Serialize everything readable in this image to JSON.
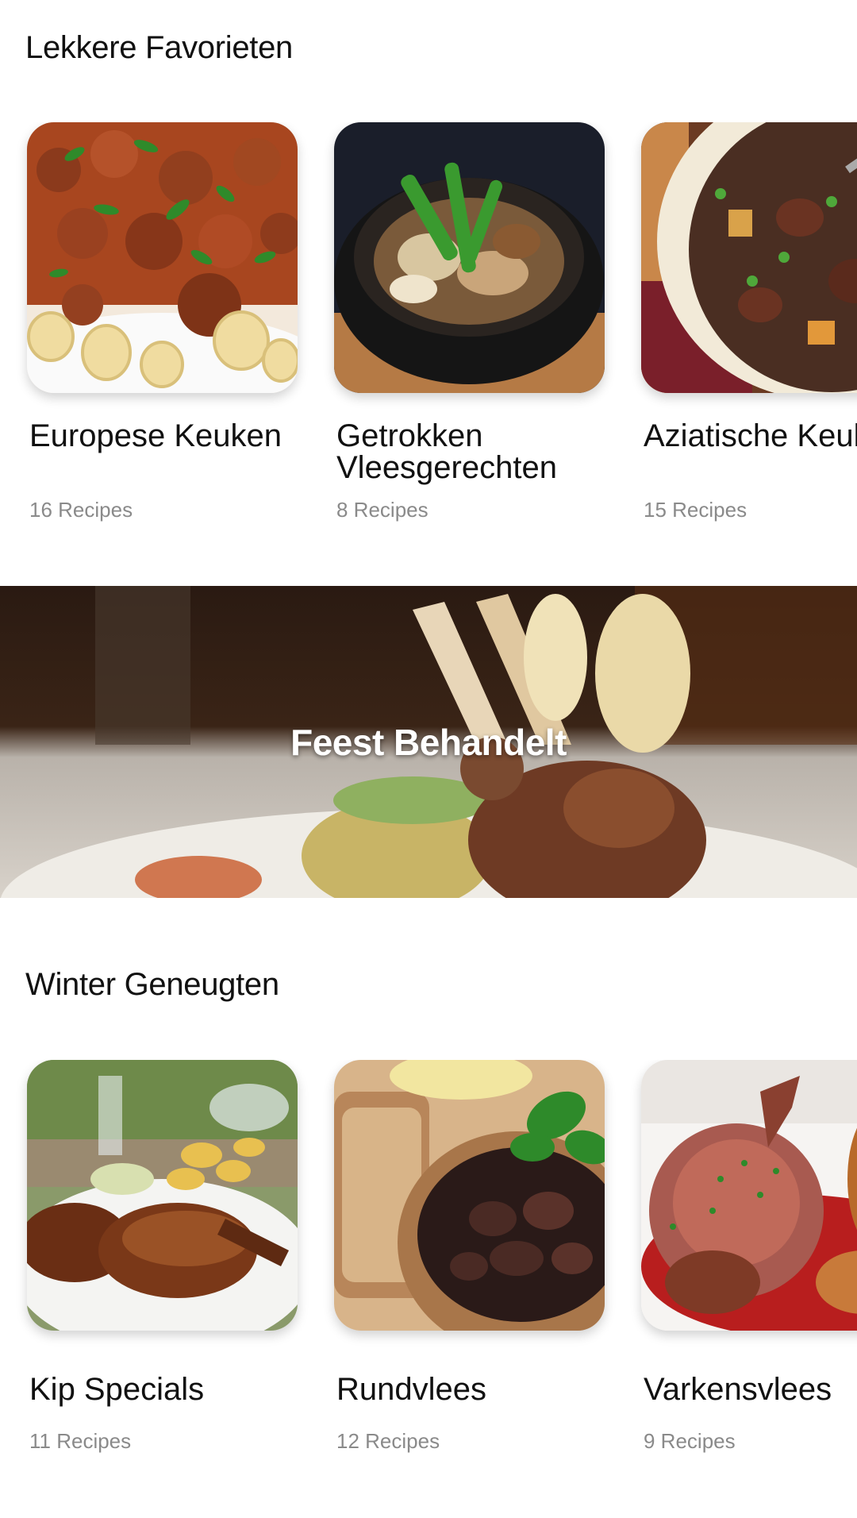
{
  "sections": [
    {
      "title": "Lekkere Favorieten",
      "cards": [
        {
          "title": "Europese Keuken",
          "count": "16 Recipes",
          "image": "pasta-bolognese-photo"
        },
        {
          "title": "Getrokken Vleesgerechten",
          "count": "8 Recipes",
          "image": "braised-meat-pot-photo"
        },
        {
          "title": "Aziatische Keuken",
          "count": "15 Recipes",
          "image": "stew-pot-photo"
        }
      ]
    },
    {
      "title": "Winter Geneugten",
      "cards": [
        {
          "title": "Kip Specials",
          "count": "11 Recipes",
          "image": "grilled-chicken-photo"
        },
        {
          "title": "Rundvlees",
          "count": "12 Recipes",
          "image": "beef-stew-bowl-photo"
        },
        {
          "title": "Varkensvlees",
          "count": "9 Recipes",
          "image": "roast-pork-photo"
        }
      ]
    }
  ],
  "banner": {
    "title": "Feest Behandelt",
    "image": "lamb-chops-plate-photo"
  }
}
